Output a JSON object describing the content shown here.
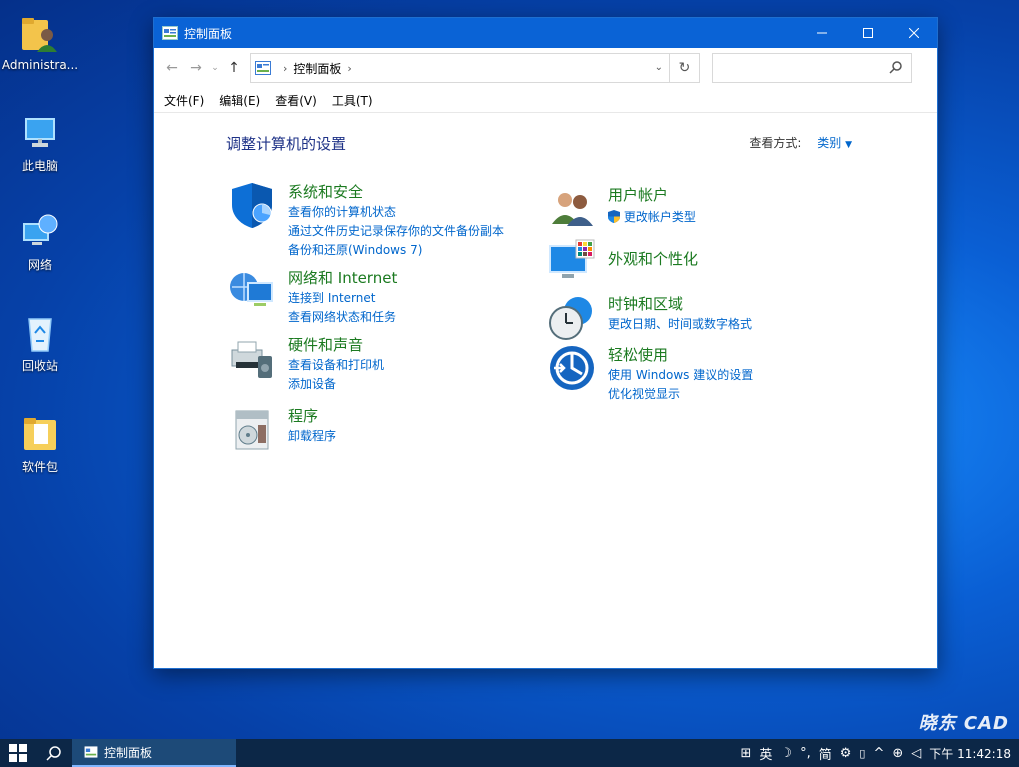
{
  "desktop": {
    "icons": [
      {
        "label": "Administra..."
      },
      {
        "label": "此电脑"
      },
      {
        "label": "网络"
      },
      {
        "label": "回收站"
      },
      {
        "label": "软件包"
      }
    ]
  },
  "window": {
    "title": "控制面板",
    "nav": {
      "address_root": "控制面板",
      "search_placeholder": ""
    },
    "menu": [
      "文件(F)",
      "编辑(E)",
      "查看(V)",
      "工具(T)"
    ],
    "heading": "调整计算机的设置",
    "view_by_label": "查看方式:",
    "view_by_value": "类别",
    "categories": [
      {
        "title": "系统和安全",
        "icon": "shield-icon",
        "links": [
          "查看你的计算机状态",
          "通过文件历史记录保存你的文件备份副本",
          "备份和还原(Windows 7)"
        ]
      },
      {
        "title": "网络和 Internet",
        "icon": "network-icon",
        "links": [
          "连接到 Internet",
          "查看网络状态和任务"
        ]
      },
      {
        "title": "硬件和声音",
        "icon": "printer-icon",
        "links": [
          "查看设备和打印机",
          "添加设备"
        ]
      },
      {
        "title": "程序",
        "icon": "programs-icon",
        "links": [
          "卸载程序"
        ]
      },
      {
        "title": "用户帐户",
        "icon": "users-icon",
        "links": [
          "更改帐户类型"
        ]
      },
      {
        "title": "外观和个性化",
        "icon": "appearance-icon",
        "links": []
      },
      {
        "title": "时钟和区域",
        "icon": "clock-icon",
        "links": [
          "更改日期、时间或数字格式"
        ]
      },
      {
        "title": "轻松使用",
        "icon": "ease-of-access-icon",
        "links": [
          "使用 Windows 建议的设置",
          "优化视觉显示"
        ]
      }
    ]
  },
  "taskbar": {
    "app_label": "控制面板",
    "tray": {
      "ime_lang": "英",
      "ime_mode": "简",
      "clock_partial": "11:42:18",
      "prefix": "下午"
    }
  },
  "watermark": "晓东 CAD"
}
